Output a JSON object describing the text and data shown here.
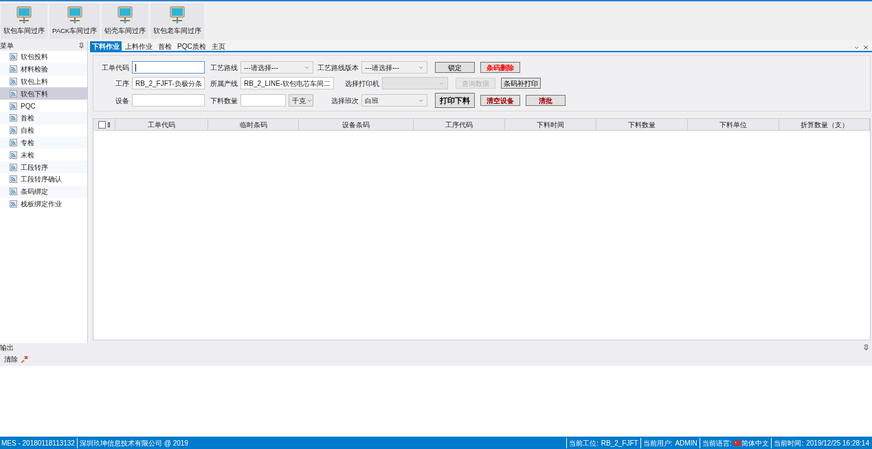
{
  "toolbar": [
    {
      "label": "软包车间过序"
    },
    {
      "label": "PACK车间过序"
    },
    {
      "label": "铝壳车间过序"
    },
    {
      "label": "软包老车间过序"
    }
  ],
  "sidebar": {
    "title": "菜单",
    "items": [
      {
        "label": "软包投料",
        "selected": false
      },
      {
        "label": "材料检验",
        "selected": false
      },
      {
        "label": "软包上料",
        "selected": false
      },
      {
        "label": "软包下料",
        "selected": true
      },
      {
        "label": "PQC",
        "selected": false
      },
      {
        "label": "首检",
        "selected": false
      },
      {
        "label": "自检",
        "selected": false
      },
      {
        "label": "专检",
        "selected": false
      },
      {
        "label": "末检",
        "selected": false
      },
      {
        "label": "工段转序",
        "selected": false
      },
      {
        "label": "工段转序确认",
        "selected": false
      },
      {
        "label": "条码绑定",
        "selected": false
      },
      {
        "label": "栈板绑定作业",
        "selected": false
      }
    ]
  },
  "tabs": [
    {
      "label": "下料作业",
      "selected": true
    },
    {
      "label": "上料作业",
      "selected": false
    },
    {
      "label": "首检",
      "selected": false
    },
    {
      "label": "PQC质检",
      "selected": false
    },
    {
      "label": "主页",
      "selected": false
    }
  ],
  "form": {
    "rows": [
      [
        {
          "kind": "input",
          "label": "工单代码",
          "focused": true
        },
        {
          "kind": "select",
          "label": "工艺路线",
          "value": "---请选择---",
          "disabled": false
        },
        {
          "kind": "select",
          "label": "工艺路线版本",
          "value": "---请选择---",
          "disabled": false
        },
        {
          "kind": "button",
          "label": "锁定",
          "disabled": false
        },
        {
          "kind": "danger",
          "label": "条码删除"
        }
      ],
      [
        {
          "kind": "input",
          "label": "工序",
          "value": "RB_2_FJFT-负极分条",
          "focused": false
        },
        {
          "kind": "input",
          "label": "所属产线",
          "value": "RB_2_LINE-软包电芯车间二",
          "focused": false
        },
        {
          "kind": "select",
          "label": "选择打印机",
          "disabled": true
        },
        {
          "kind": "button",
          "label": "查询数据",
          "disabled": true
        },
        {
          "kind": "button",
          "label": "条码补打印",
          "disabled": false
        }
      ],
      [
        {
          "kind": "input",
          "label": "设备",
          "focused": false
        },
        {
          "kind": "input_unit",
          "label": "下料数量",
          "unit": "千克"
        },
        {
          "kind": "select",
          "label": "选择班次",
          "value": "白班",
          "disabled": false
        },
        {
          "kind": "primary",
          "label": "打印下料"
        },
        {
          "kind": "warning",
          "label": "清空设备"
        },
        {
          "kind": "warning",
          "label": "清批"
        }
      ]
    ]
  },
  "table": {
    "checked": false,
    "columns": [
      "工单代码",
      "临时条码",
      "设备条码",
      "工序代码",
      "下料时间",
      "下料数量",
      "下料单位",
      "折算数量（支）"
    ]
  },
  "output": {
    "title": "输出",
    "clear_button": "清除"
  },
  "status_bar": {
    "left": [
      "MES - 20180118113132",
      "深圳玖坤信息技术有限公司 @ 2019"
    ],
    "right": [
      {
        "label": "当前工位:",
        "value": "RB_2_FJFT",
        "flag": false
      },
      {
        "label": "当前用户:",
        "value": "ADMIN",
        "flag": false
      },
      {
        "label": "当前语言:",
        "value": "简体中文",
        "flag": true
      },
      {
        "label": "当前时间:",
        "value": "2019/12/25 16:28:14",
        "flag": false
      }
    ]
  }
}
